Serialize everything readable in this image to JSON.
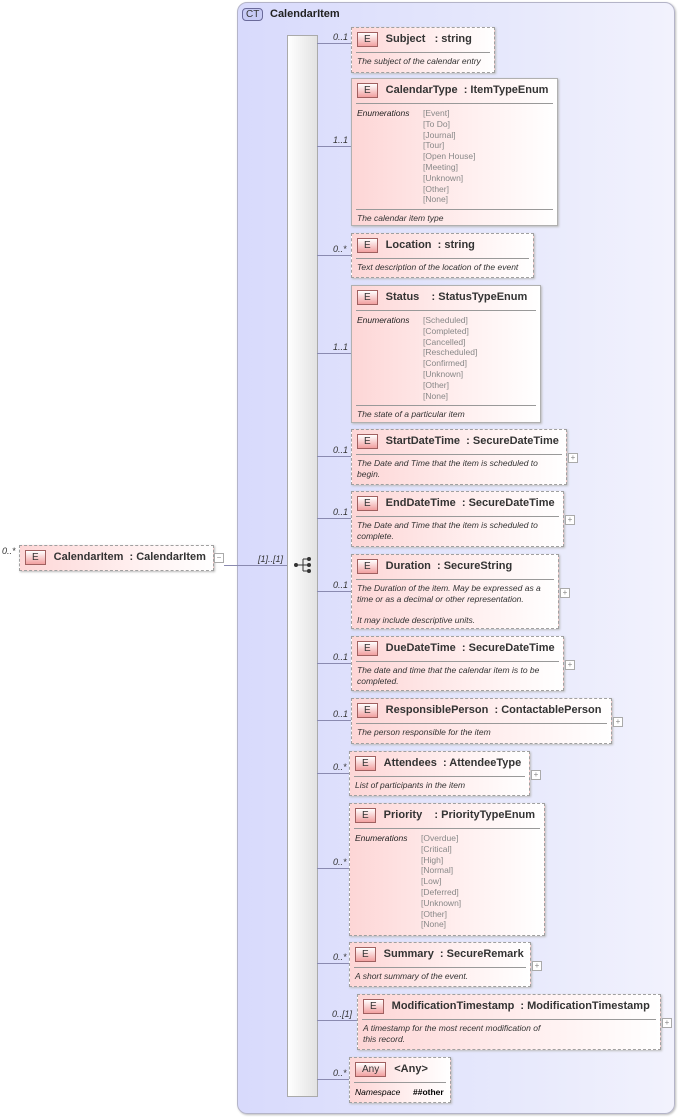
{
  "complex_type": {
    "badge": "CT",
    "name": "CalendarItem"
  },
  "root_element": {
    "badge": "E",
    "label": "CalendarItem  : CalendarItem",
    "cardinality": "0..*",
    "sequence_cardinality": "[1]..[1]",
    "collapse": "−"
  },
  "children": [
    {
      "label": "Subject   : string",
      "card": "0..1",
      "optional": true,
      "desc": "The subject of the calendar entry"
    },
    {
      "label": "CalendarType  : ItemTypeEnum",
      "card": "1..1",
      "optional": false,
      "enum_label": "Enumerations",
      "enums": [
        "[Event]",
        "[To Do]",
        "[Journal]",
        "[Tour]",
        "[Open House]",
        "[Meeting]",
        "[Unknown]",
        "[Other]",
        "[None]"
      ],
      "desc": "The calendar item type"
    },
    {
      "label": "Location  : string",
      "card": "0..*",
      "optional": true,
      "desc": "Text description of the location of the event"
    },
    {
      "label": "Status    : StatusTypeEnum",
      "card": "1..1",
      "optional": false,
      "enum_label": "Enumerations",
      "enums": [
        "[Scheduled]",
        "[Completed]",
        "[Cancelled]",
        "[Rescheduled]",
        "[Confirmed]",
        "[Unknown]",
        "[Other]",
        "[None]"
      ],
      "desc": "The state of a particular item"
    },
    {
      "label": "StartDateTime  : SecureDateTime",
      "card": "0..1",
      "optional": true,
      "expand": "+",
      "desc": "The Date and Time that the item is scheduled to begin."
    },
    {
      "label": "EndDateTime  : SecureDateTime",
      "card": "0..1",
      "optional": true,
      "expand": "+",
      "desc": "The Date and Time that the item is scheduled to complete."
    },
    {
      "label": "Duration  : SecureString",
      "card": "0..1",
      "optional": true,
      "expand": "+",
      "desc": "The Duration of the item. May be expressed as a time or as a decimal or other representation.\n\nIt may include descriptive units."
    },
    {
      "label": "DueDateTime  : SecureDateTime",
      "card": "0..1",
      "optional": true,
      "expand": "+",
      "desc": "The date and time that the calendar item is to be completed."
    },
    {
      "label": "ResponsiblePerson  : ContactablePerson",
      "card": "0..1",
      "optional": true,
      "expand": "+",
      "desc": "The person responsible for the item"
    },
    {
      "label": "Attendees  : AttendeeType",
      "card": "0..*",
      "optional": true,
      "expand": "+",
      "desc": "List of participants in the item"
    },
    {
      "label": "Priority    : PriorityTypeEnum",
      "card": "0..*",
      "optional": true,
      "enum_label": "Enumerations",
      "enums": [
        "[Overdue]",
        "[Critical]",
        "[High]",
        "[Normal]",
        "[Low]",
        "[Deferred]",
        "[Unknown]",
        "[Other]",
        "[None]"
      ]
    },
    {
      "label": "Summary  : SecureRemark",
      "card": "0..*",
      "optional": true,
      "expand": "+",
      "desc": "A short summary of the event."
    },
    {
      "label": "ModificationTimestamp  : ModificationTimestamp",
      "card": "0..[1]",
      "optional": true,
      "expand": "+",
      "desc": "A timestamp for the most recent modification of\nthis record."
    },
    {
      "label": "<Any>",
      "badge": "Any",
      "card": "0..*",
      "optional": true,
      "ns_label": "Namespace",
      "ns_value": "##other"
    }
  ]
}
